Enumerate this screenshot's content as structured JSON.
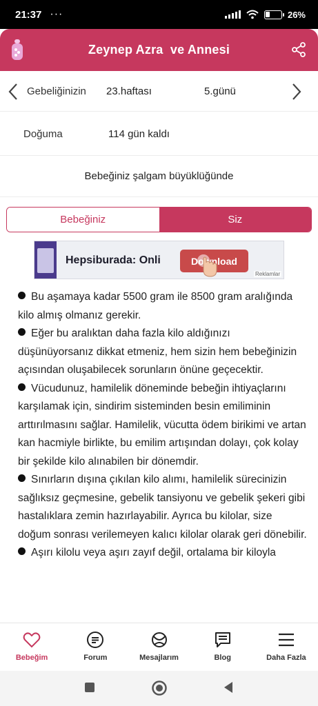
{
  "status_bar": {
    "time": "21:37",
    "dots": "···",
    "battery": "26%",
    "battery_level": 0.26
  },
  "header": {
    "title": "Zeynep Azra  ve Annesi",
    "share_icon": "share-icon",
    "logo": "baby-bottle-logo"
  },
  "pregnancy": {
    "week_label": "Gebeliğinizin",
    "week_value": "23.haftası",
    "day_value": "5.günü",
    "birth_label": "Doğuma",
    "birth_days": "114",
    "birth_suffix": " gün kaldı",
    "size_text": "Bebeğiniz şalgam büyüklüğünde"
  },
  "tabs": [
    {
      "label": "Bebeğiniz",
      "active": false
    },
    {
      "label": "Siz",
      "active": true
    }
  ],
  "ad": {
    "text": "Hepsiburada: Onli",
    "cta": "Download",
    "badge": "Reklamlar"
  },
  "article": {
    "paragraphs": [
      "Bu aşamaya kadar 5500 gram ile 8500 gram aralığında kilo almış olmanız gerekir.",
      "Eğer bu aralıktan daha fazla kilo aldığınızı düşünüyorsanız dikkat etmeniz, hem sizin hem bebeğinizin açısından oluşabilecek sorunların önüne geçecektir.",
      "Vücudunuz, hamilelik döneminde bebeğin ihtiyaçlarını karşılamak için, sindirim sisteminden besin emiliminin arttırılmasını sağlar. Hamilelik, vücutta ödem birikimi ve artan kan hacmiyle birlikte, bu emilim artışından dolayı, çok kolay bir şekilde kilo alınabilen bir dönemdir.",
      "Sınırların dışına çıkılan kilo alımı, hamilelik sürecinizin sağlıksız geçmesine, gebelik tansiyonu ve gebelik şekeri gibi hastalıklara zemin hazırlayabilir. Ayrıca bu kilolar, size doğum sonrası verilemeyen kalıcı kilolar olarak geri dönebilir.",
      "Aşırı kilolu veya aşırı zayıf değil, ortalama bir kiloyla"
    ]
  },
  "bottom_nav": [
    {
      "label": "Bebeğim",
      "icon": "heart-icon",
      "active": true
    },
    {
      "label": "Forum",
      "icon": "forum-icon",
      "active": false
    },
    {
      "label": "Mesajlarım",
      "icon": "messages-icon",
      "active": false
    },
    {
      "label": "Blog",
      "icon": "blog-icon",
      "active": false
    },
    {
      "label": "Daha Fazla",
      "icon": "menu-icon",
      "active": false
    }
  ],
  "colors": {
    "accent": "#c6385e",
    "text": "#222222",
    "divider": "#ececec"
  }
}
